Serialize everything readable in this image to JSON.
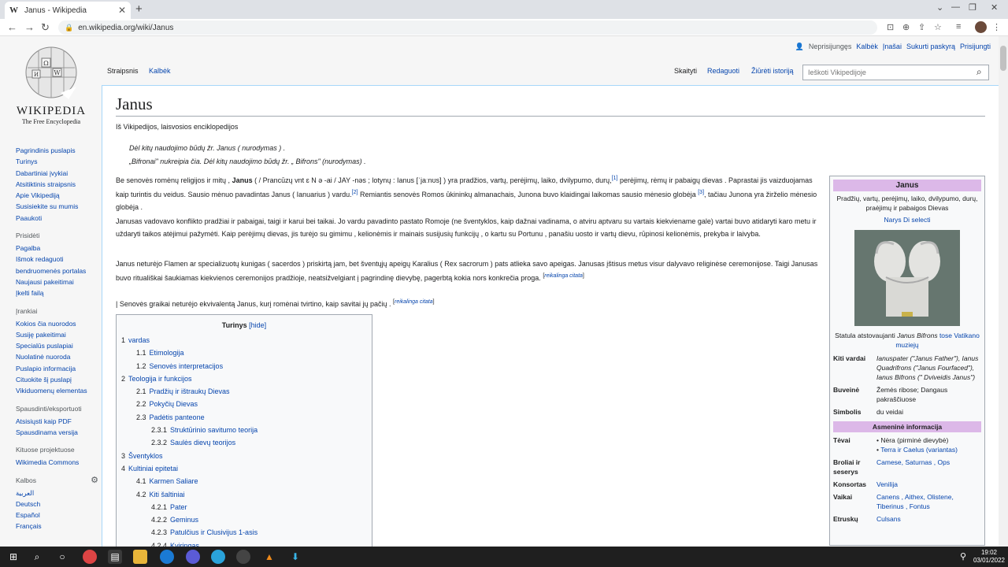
{
  "browser": {
    "tab_title": "Janus - Wikipedia",
    "tab_favicon": "W",
    "url": "en.wikipedia.org/wiki/Janus"
  },
  "logo": {
    "wordmark": "WIKIPEDIA",
    "tagline": "The Free Encyclopedia"
  },
  "personal": {
    "anon": "Neprisijungęs",
    "talk": "Kalbėk",
    "contrib": "Įnašai",
    "create": "Sukurti paskyrą",
    "login": "Prisijungti"
  },
  "page_tabs": {
    "article": "Straipsnis",
    "talk": "Kalbėk",
    "read": "Skaityti",
    "edit": "Redaguoti",
    "history": "Žiūrėti istoriją"
  },
  "search": {
    "placeholder": "Ieškoti Vikipedijoje"
  },
  "sidebar": {
    "nav": [
      "Pagrindinis puslapis",
      "Turinys",
      "Dabartiniai įvykiai",
      "Atsitiktinis straipsnis",
      "Apie Vikipediją",
      "Susisiekite su mumis",
      "Paaukoti"
    ],
    "contribute_head": "Prisidėti",
    "contribute": [
      "Pagalba",
      "Išmok redaguoti",
      "bendruomenės portalas",
      "Naujausi pakeitimai",
      "Įkelti failą"
    ],
    "tools_head": "Įrankiai",
    "tools": [
      "Kokios čia nuorodos",
      "Susiję pakeitimai",
      "Specialūs puslapiai",
      "Nuolatinė nuoroda",
      "Puslapio informacija",
      "Cituokite šį puslapį",
      "Vikiduomenų elementas"
    ],
    "print_head": "Spausdinti/eksportuoti",
    "print": [
      "Atsisiųsti kaip PDF",
      "Spausdinama versija"
    ],
    "projects_head": "Kituose projektuose",
    "projects": [
      "Wikimedia Commons"
    ],
    "languages_head": "Kalbos",
    "languages": [
      "العربية",
      "Deutsch",
      "Español",
      "Français"
    ]
  },
  "article": {
    "title": "Janus",
    "from": "Iš Vikipedijos, laisvosios enciklopedijos",
    "hatnote1": "Dėl kitų naudojimo būdų žr. Janus ( nurodymas ) .",
    "hatnote2": "„Bifronai\" nukreipia čia. Dėl kitų naudojimo būdų žr. „ Bifrons\" (nurodymas) .",
    "p1a": "Be senovės romėnų religijos ir mitų , ",
    "p1b": "Janus",
    "p1c": " ( / Prancūzų vnt ɛ N ə -ai / JAY -nəs ; lotynų : Ianus [ˈjaːnʊs] ) yra pradžios, vartų, perėjimų, laiko, dvilypumo, durų,",
    "p1sup1": "[1]",
    "p1d": " perėjimų, rėmų ir pabaigų dievas . Paprastai jis vaizduojamas kaip turintis du veidus. Sausio mėnuo pavadintas Janus ( Ianuarius ) vardu.",
    "p1sup2": "[2]",
    "p1e": " Remiantis senovės Romos ūkininkų almanachais, Junona buvo klaidingai laikomas sausio mėnesio globėja",
    "p1sup3": "[3]",
    "p1f": ", tačiau Junona yra žirželio mėnesio globėja .",
    "p2": "Janusas vadovavo konflikto pradžiai ir pabaigai, taigi ir karui bei taikai. Jo vardu pavadinto pastato Romoje (ne šventyklos, kaip dažnai vadinama, o atviru aptvaru su vartais kiekviename gale) vartai buvo atidaryti karo metu ir uždaryti taikos atėjimui pažymėti. Kaip perėjimų dievas, jis turėjo su gimimu , kelionėmis ir mainais susijusių funkcijų , o kartu su Portunu , panašiu uosto ir vartų dievu, rūpinosi kelionėmis, prekyba ir laivyba.",
    "p3": "Janus neturėjo Flamen ar specializuotų kunigas ( sacerdos ) priskirtą jam, bet šventųjų apeigų Karalius ( Rex sacrorum ) pats atlieka savo apeigas. Janusas įštisus metus visur dalyvavo religinėse ceremonijose. Taigi Janusas buvo rituališkai šaukiamas kiekvienos ceremonijos pradžioje, neatsižvelgiant į pagrindinę dievybę, pagerbtą kokia nors konkrečia proga.",
    "cite_needed": "reikalinga citata",
    "p4": "| Senovės graikai neturėjo ekvivalentą Janus, kurį romėnai tvirtino, kaip savitai jų pačių ."
  },
  "toc": {
    "title": "Turinys",
    "hide": "[hide]",
    "items": [
      {
        "num": "1",
        "text": "vardas",
        "level": 1
      },
      {
        "num": "1.1",
        "text": "Etimologija",
        "level": 2
      },
      {
        "num": "1.2",
        "text": "Senovės interpretacijos",
        "level": 2
      },
      {
        "num": "2",
        "text": "Teologija ir funkcijos",
        "level": 1
      },
      {
        "num": "2.1",
        "text": "Pradžių ir ištraukų Dievas",
        "level": 2
      },
      {
        "num": "2.2",
        "text": "Pokyčių Dievas",
        "level": 2
      },
      {
        "num": "2.3",
        "text": "Padėtis panteone",
        "level": 2
      },
      {
        "num": "2.3.1",
        "text": "Struktūrinio savitumo teorija",
        "level": 3
      },
      {
        "num": "2.3.2",
        "text": "Saulės dievų teorijos",
        "level": 3
      },
      {
        "num": "3",
        "text": "Šventyklos",
        "level": 1
      },
      {
        "num": "4",
        "text": "Kultiniai epitetai",
        "level": 1
      },
      {
        "num": "4.1",
        "text": "Karmen Saliare",
        "level": 2
      },
      {
        "num": "4.2",
        "text": "Kiti šaltiniai",
        "level": 2
      },
      {
        "num": "4.2.1",
        "text": "Pater",
        "level": 3
      },
      {
        "num": "4.2.2",
        "text": "Geminus",
        "level": 3
      },
      {
        "num": "4.2.3",
        "text": "Patulčius ir Clusivijus 1-asis",
        "level": 3
      },
      {
        "num": "4.2.4",
        "text": "Kviringas",
        "level": 3
      }
    ]
  },
  "infobox": {
    "title": "Janus",
    "caption": "Pradžių, vartų, perėjimų, laiko, dvilypumo, durų, praėjimų ir pabaigos Dievas",
    "member": "Narys Di selecti",
    "image_caption_a": "Statula atstovaujanti ",
    "image_caption_b": "Janus Bifrons",
    "image_caption_c": " tose Vatikano muziejų",
    "rows": [
      {
        "k": "Kiti vardai",
        "v": "Ianuspater (\"Janus Father\"), Ianus Quadrifrons (\"Janus Fourfaced\"), Ianus Bifrons (\" Dviveidis Janus\")"
      },
      {
        "k": "Buveinė",
        "v": "Žemės ribose; Dangaus pakraščiuose"
      },
      {
        "k": "Simbolis",
        "v": "du veidai"
      }
    ],
    "personal_head": "Asmeninė informacija",
    "parents_k": "Tėvai",
    "parents": [
      "Nėra (pirminė dievybė)",
      "Terra ir Caelus (variantas)"
    ],
    "rows2": [
      {
        "k": "Broliai ir seserys",
        "v": "Camese, Saturnas , Ops"
      },
      {
        "k": "Konsortas",
        "v": "Venilija"
      },
      {
        "k": "Vaikai",
        "v": "Canens , Aithex, Olistene, Tiberinus , Fontus"
      },
      {
        "k": "Etruskų",
        "v": "Culsans"
      }
    ]
  },
  "clock": {
    "time": "19:02",
    "date": "03/01/2022"
  }
}
